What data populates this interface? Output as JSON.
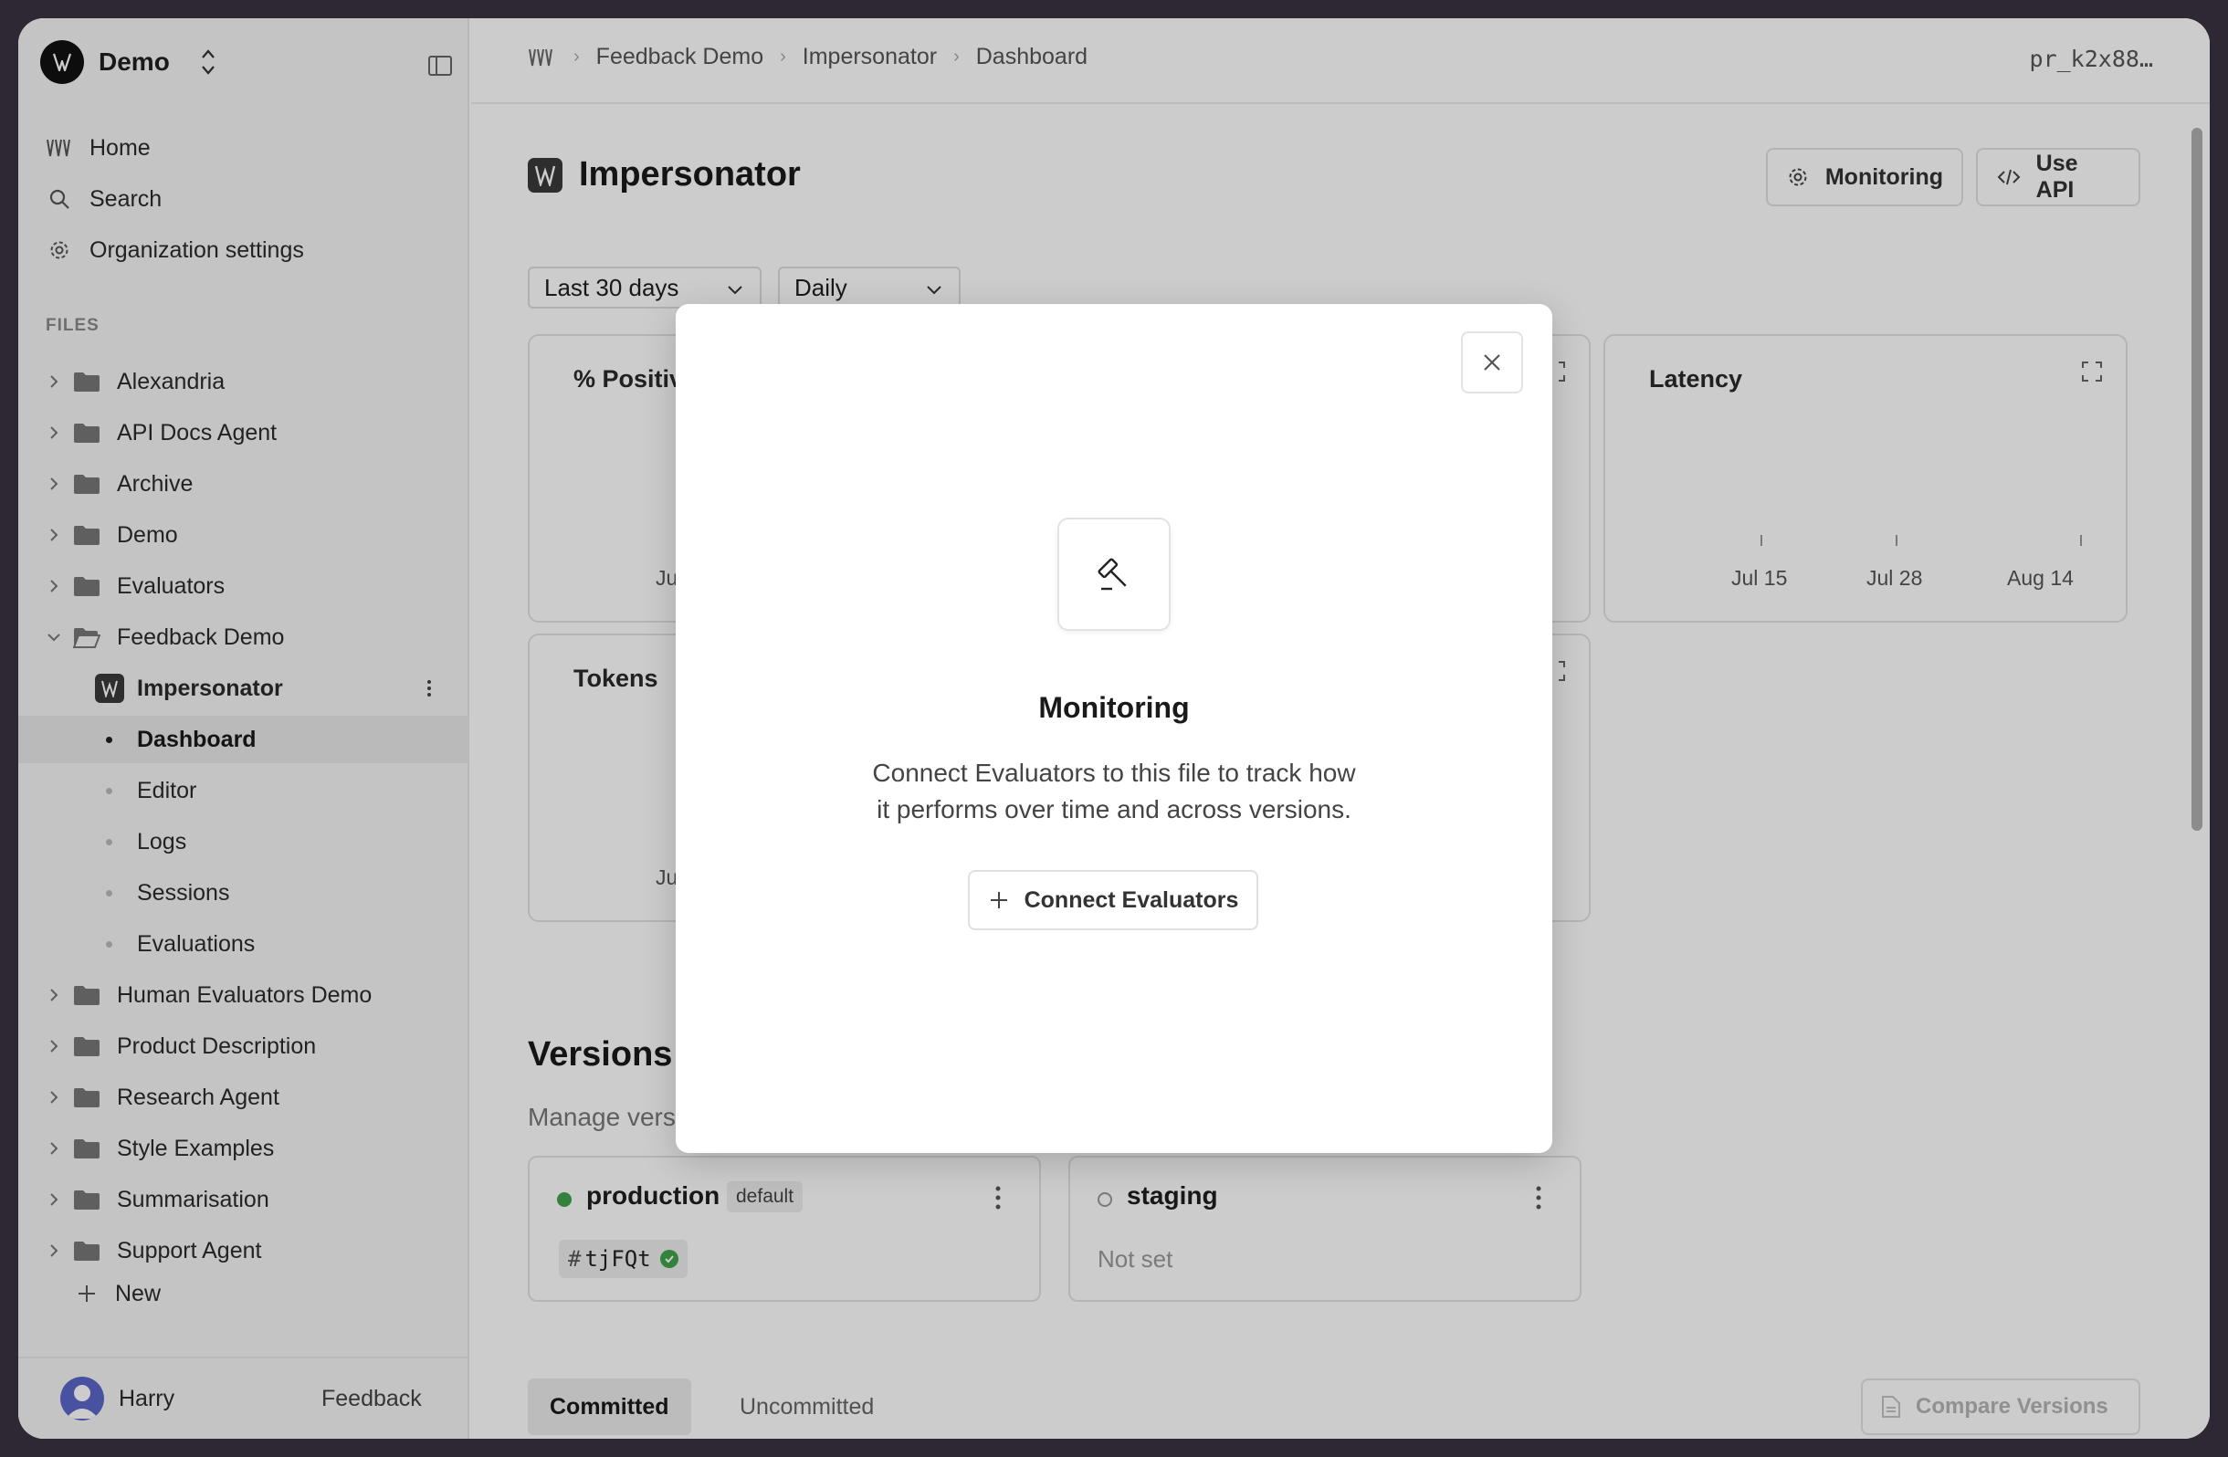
{
  "org": {
    "name": "Demo"
  },
  "nav": {
    "home": "Home",
    "search": "Search",
    "org_settings": "Organization settings"
  },
  "files_label": "FILES",
  "folders": [
    "Alexandria",
    "API Docs Agent",
    "Archive",
    "Demo",
    "Evaluators",
    "Feedback Demo"
  ],
  "file": {
    "name": "Impersonator"
  },
  "file_views": [
    "Dashboard",
    "Editor",
    "Logs",
    "Sessions",
    "Evaluations"
  ],
  "folders_after": [
    "Human Evaluators Demo",
    "Product Description",
    "Research Agent",
    "Style Examples",
    "Summarisation",
    "Support Agent"
  ],
  "new_label": "New",
  "user": {
    "name": "Harry",
    "feedback": "Feedback"
  },
  "breadcrumb": [
    "Feedback Demo",
    "Impersonator",
    "Dashboard"
  ],
  "project_id": "pr_k2x88…",
  "page": {
    "title": "Impersonator"
  },
  "header_buttons": {
    "monitoring": "Monitoring",
    "use_api": "Use API"
  },
  "filters": {
    "range": "Last 30 days",
    "interval": "Daily"
  },
  "cards": {
    "positive": "% Positiv",
    "positive_axis": "Ju",
    "tokens": "Tokens",
    "tokens_axis": "Ju",
    "latency": "Latency",
    "latency_axis": [
      "Jul 15",
      "Jul 28",
      "Aug 14"
    ]
  },
  "versions": {
    "title": "Versions",
    "subtitle": "Manage vers",
    "production": {
      "name": "production",
      "badge": "default",
      "hash_symbol": "#",
      "hash": "tjFQt",
      "status_color": "#3fa34d"
    },
    "staging": {
      "name": "staging",
      "value": "Not set"
    }
  },
  "tabs": {
    "committed": "Committed",
    "uncommitted": "Uncommitted"
  },
  "compare_versions": "Compare Versions",
  "modal": {
    "title": "Monitoring",
    "description_line1": "Connect Evaluators to this file to track how",
    "description_line2": "it performs over time and across versions.",
    "button": "Connect Evaluators"
  }
}
